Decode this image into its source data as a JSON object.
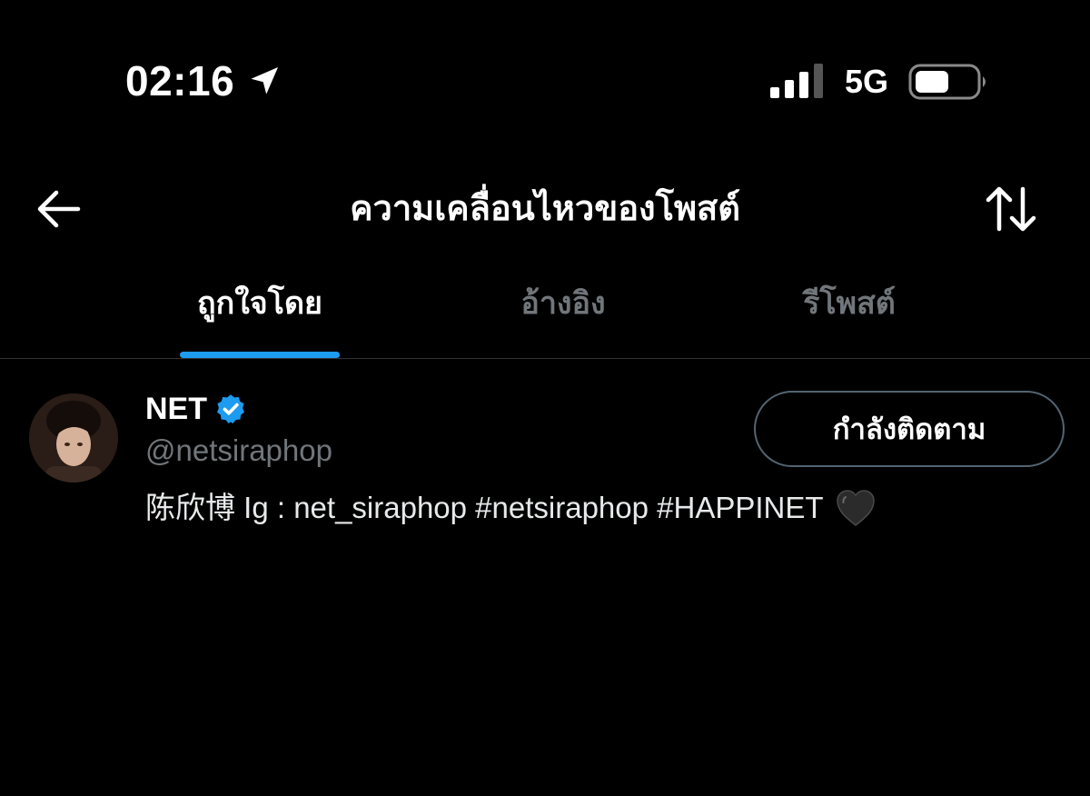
{
  "status_bar": {
    "time": "02:16",
    "network": "5G",
    "icons": [
      "location-arrow-icon",
      "cellular-signal-icon",
      "battery-icon"
    ]
  },
  "header": {
    "title": "ความเคลื่อนไหวของโพสต์",
    "back_icon": "back-arrow-icon",
    "sort_icon": "sort-arrows-icon"
  },
  "tabs": [
    {
      "label": "ถูกใจโดย",
      "active": true
    },
    {
      "label": "อ้างอิง",
      "active": false
    },
    {
      "label": "รีโพสต์",
      "active": false
    }
  ],
  "user": {
    "display_name": "NET",
    "verified": true,
    "handle": "@netsiraphop",
    "bio": "陈欣博 Ig : net_siraphop #netsiraphop #HAPPINET",
    "bio_emoji_icon": "black-heart-icon",
    "follow_button_label": "กำลังติดตาม"
  },
  "colors": {
    "background": "#000000",
    "accent": "#1d9bf0",
    "primary_text": "#ffffff",
    "secondary_text": "#71767b",
    "divider": "#2f3336"
  }
}
